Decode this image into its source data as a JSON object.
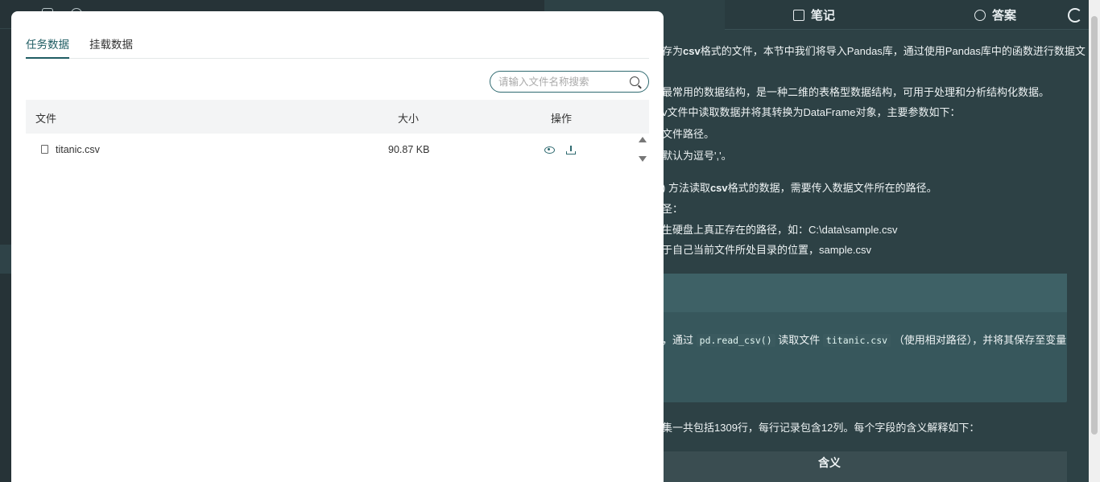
{
  "right_tabs": {
    "notes_label": "笔记",
    "answer_label": "答案"
  },
  "content": {
    "line1a": "存为",
    "line1b": "csv",
    "line1c": "格式的文件，本节中我们将导入Pandas库，通过使用Pandas库中的函数进行数据文",
    "line2": "最常用的数据结构，是一种二维的表格型数据结构，可用于处理和分析结构化数据。",
    "line3": "v文件中读取数据并将其转换为DataFrame对象，主要参数如下：",
    "line4": "文件路径。",
    "line5": "默认为逗号','。",
    "line6a": ") 方法读取",
    "line6b": "csv",
    "line6c": "格式的数据，需要传入数据文件所在的路径。",
    "line7": "圣：",
    "line8": "生硬盘上真正存在的路径，如：C:\\data\\sample.csv",
    "line9": "于自己当前文件所处目录的位置，sample.csv",
    "task_a": "，通过",
    "task_code1": "pd.read_csv()",
    "task_b": "读取文件",
    "task_code2": "titanic.csv",
    "task_c": "（使用相对路径），并将其保存至变量",
    "line10": "集一共包括1309行，每行记录包含12列。每个字段的含义解释如下：",
    "table_header": "含义"
  },
  "modal": {
    "tabs": [
      "任务数据",
      "挂载数据"
    ],
    "search_placeholder": "请输入文件名称搜索",
    "columns": {
      "file": "文件",
      "size": "大小",
      "actions": "操作"
    },
    "files": [
      {
        "name": "titanic.csv",
        "size": "90.87 KB"
      }
    ]
  }
}
